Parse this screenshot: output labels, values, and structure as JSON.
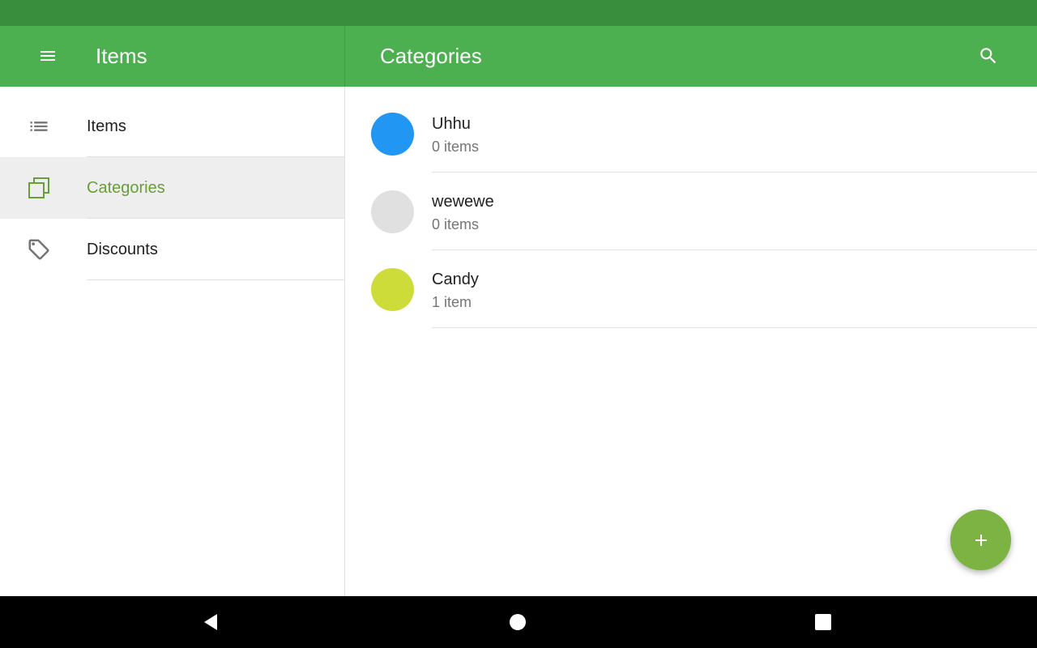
{
  "app_bar": {
    "left_title": "Items",
    "right_title": "Categories",
    "color": "#4caf50",
    "status_bar_color": "#388e3c",
    "menu_icon": "menu-icon",
    "search_icon": "search-icon"
  },
  "sidebar": {
    "items": [
      {
        "label": "Items",
        "icon": "list-icon",
        "selected": false
      },
      {
        "label": "Categories",
        "icon": "categories-icon",
        "selected": true
      },
      {
        "label": "Discounts",
        "icon": "tag-icon",
        "selected": false
      }
    ],
    "selected_color": "#689f38"
  },
  "categories": [
    {
      "name": "Uhhu",
      "count": "0 items",
      "color": "#2196f3"
    },
    {
      "name": "wewewe",
      "count": "0 items",
      "color": "#e0e0e0"
    },
    {
      "name": "Candy",
      "count": "1 item",
      "color": "#cddc39"
    }
  ],
  "fab": {
    "icon": "plus-icon",
    "color": "#7cb342"
  },
  "system_nav": {
    "back_icon": "back-icon",
    "home_icon": "home-icon",
    "recents_icon": "recents-icon"
  }
}
